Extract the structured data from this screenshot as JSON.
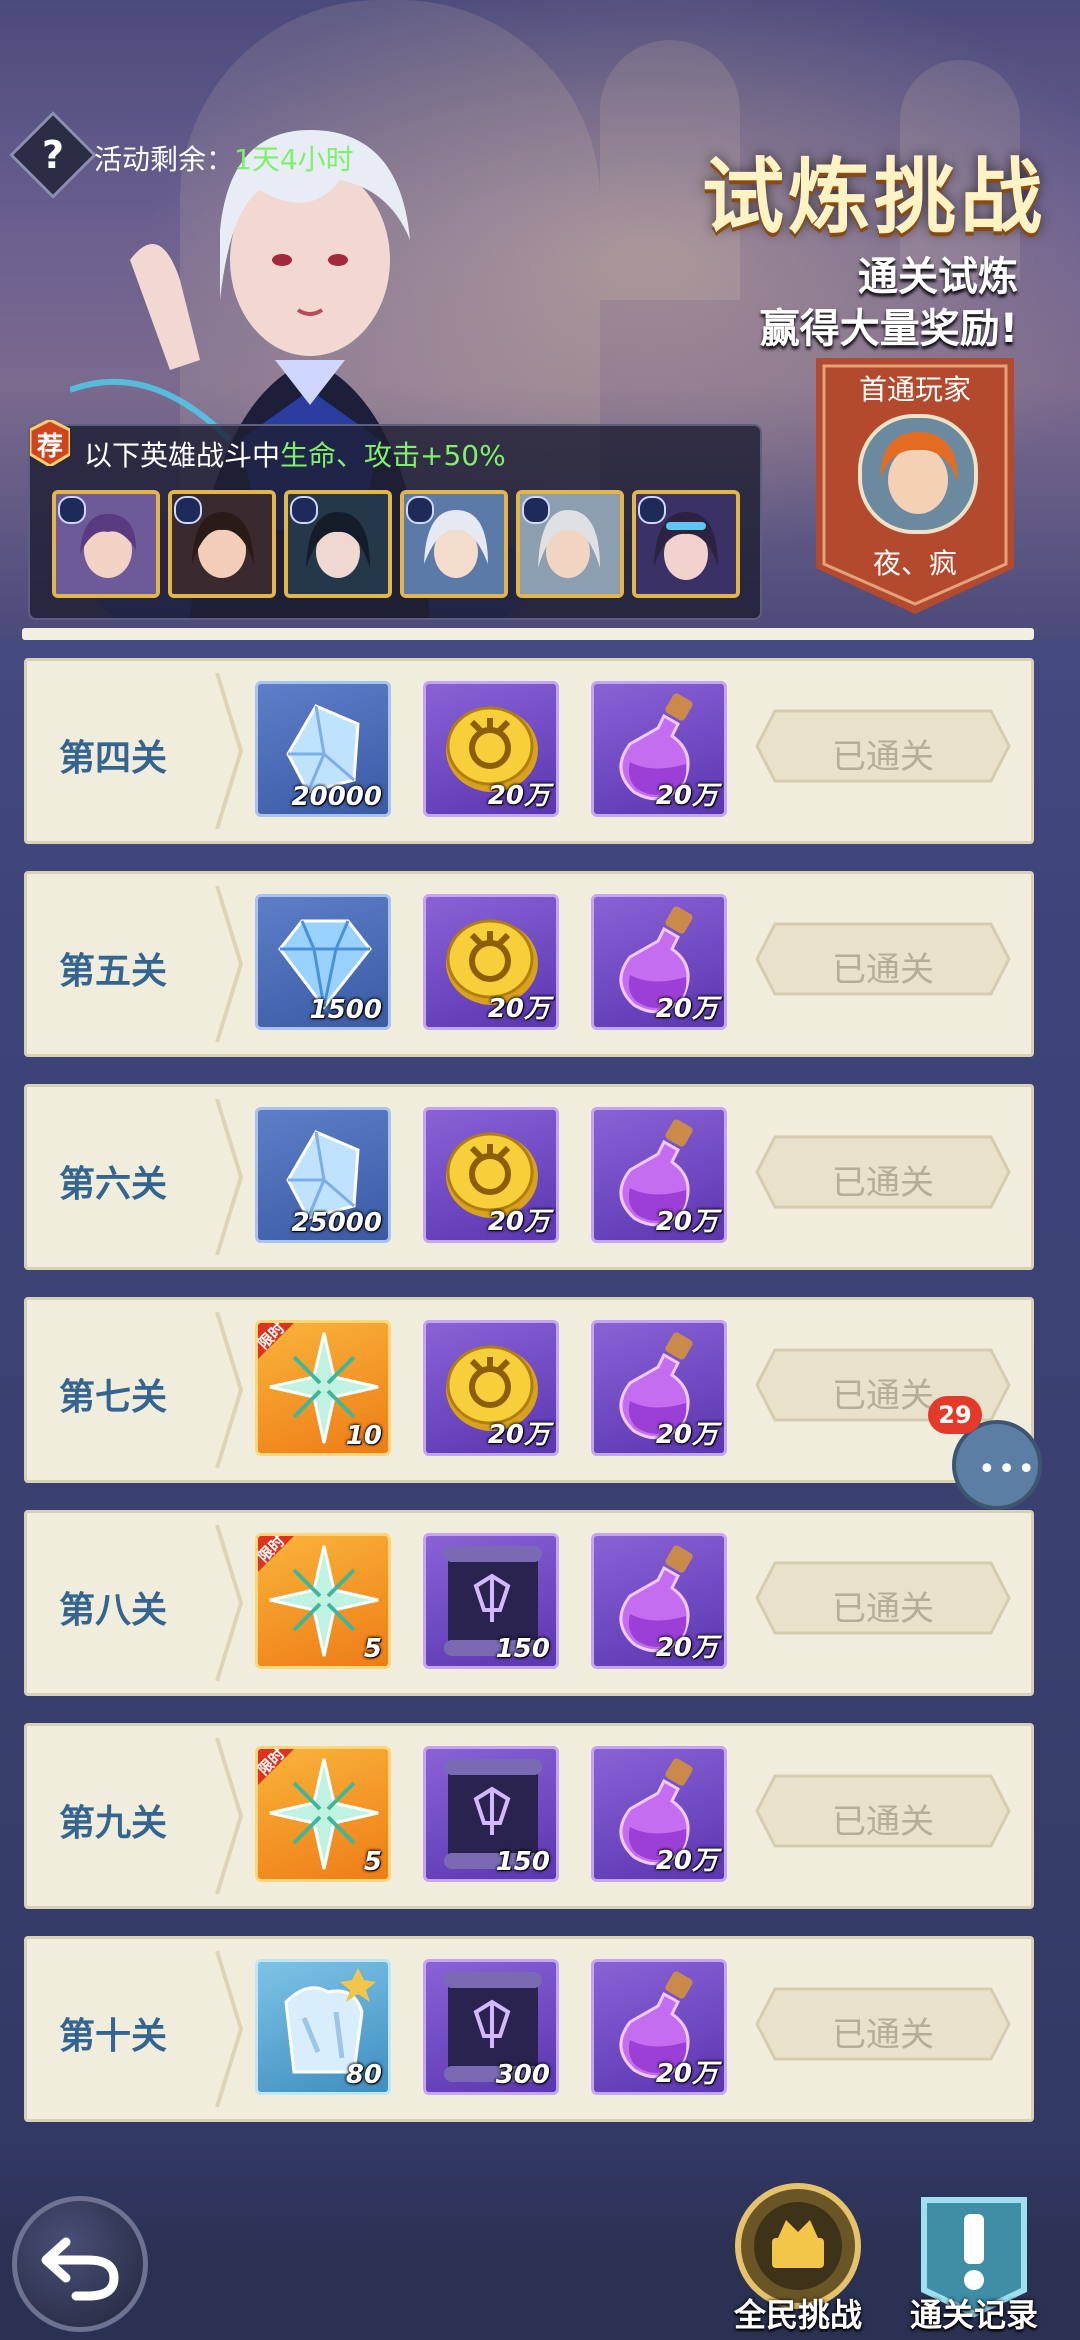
{
  "header": {
    "activity_label": "活动剩余：",
    "activity_value": "1天4小时",
    "help_icon": "?",
    "title": "试炼挑战",
    "subtitle_line1": "通关试炼",
    "subtitle_line2": "赢得大量奖励!"
  },
  "first_clear": {
    "label": "首通玩家",
    "player_name": "夜、疯"
  },
  "recommend": {
    "badge": "荐",
    "text_prefix": "以下英雄战斗中",
    "text_highlight": "生命、攻击+50%",
    "heroes": [
      "hero-1",
      "hero-2",
      "hero-3",
      "hero-4",
      "hero-5",
      "hero-6"
    ]
  },
  "stages": [
    {
      "name": "第四关",
      "rewards": [
        {
          "icon": "blue-crystal-icon",
          "qty": "20000",
          "style": "blue"
        },
        {
          "icon": "gold-coin-icon",
          "qty": "20万",
          "style": "purple"
        },
        {
          "icon": "potion-bottle-icon",
          "qty": "20万",
          "style": "purple"
        }
      ],
      "status": "已通关"
    },
    {
      "name": "第五关",
      "rewards": [
        {
          "icon": "diamond-icon",
          "qty": "1500",
          "style": "blue"
        },
        {
          "icon": "gold-coin-icon",
          "qty": "20万",
          "style": "purple"
        },
        {
          "icon": "potion-bottle-icon",
          "qty": "20万",
          "style": "purple"
        }
      ],
      "status": "已通关"
    },
    {
      "name": "第六关",
      "rewards": [
        {
          "icon": "blue-crystal-icon",
          "qty": "25000",
          "style": "blue"
        },
        {
          "icon": "gold-coin-icon",
          "qty": "20万",
          "style": "purple"
        },
        {
          "icon": "potion-bottle-icon",
          "qty": "20万",
          "style": "purple"
        }
      ],
      "status": "已通关"
    },
    {
      "name": "第七关",
      "rewards": [
        {
          "icon": "limited-star-icon",
          "qty": "10",
          "style": "orange",
          "limited": "限时"
        },
        {
          "icon": "gold-coin-icon",
          "qty": "20万",
          "style": "purple"
        },
        {
          "icon": "potion-bottle-icon",
          "qty": "20万",
          "style": "purple"
        }
      ],
      "status": "已通关"
    },
    {
      "name": "第八关",
      "rewards": [
        {
          "icon": "limited-star-icon",
          "qty": "5",
          "style": "orange",
          "limited": "限时"
        },
        {
          "icon": "scroll-icon",
          "qty": "150",
          "style": "purple"
        },
        {
          "icon": "potion-bottle-icon",
          "qty": "20万",
          "style": "purple"
        }
      ],
      "status": "已通关"
    },
    {
      "name": "第九关",
      "rewards": [
        {
          "icon": "limited-star-icon",
          "qty": "5",
          "style": "orange",
          "limited": "限时"
        },
        {
          "icon": "scroll-icon",
          "qty": "150",
          "style": "purple"
        },
        {
          "icon": "potion-bottle-icon",
          "qty": "20万",
          "style": "purple"
        }
      ],
      "status": "已通关"
    },
    {
      "name": "第十关",
      "rewards": [
        {
          "icon": "hero-shard-icon",
          "qty": "80",
          "style": "teal"
        },
        {
          "icon": "scroll-icon",
          "qty": "300",
          "style": "purple"
        },
        {
          "icon": "potion-bottle-icon",
          "qty": "20万",
          "style": "purple"
        }
      ],
      "status": "已通关"
    }
  ],
  "chat": {
    "badge": "29"
  },
  "bottom": {
    "all_challenge": "全民挑战",
    "clear_record": "通关记录"
  }
}
